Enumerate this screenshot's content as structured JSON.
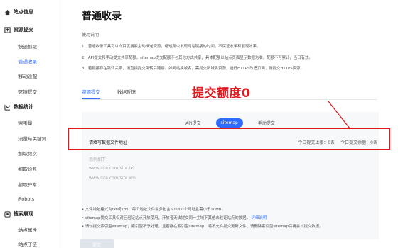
{
  "sidebar": {
    "groups": [
      {
        "label": "站点信息",
        "icon": "home-icon"
      },
      {
        "label": "资源提交",
        "icon": "upload-icon"
      },
      {
        "label": "数据统计",
        "icon": "chart-icon"
      },
      {
        "label": "搜索展现",
        "icon": "search-display-icon"
      }
    ],
    "items": [
      {
        "label": "快速抓取"
      },
      {
        "label": "普通收录"
      },
      {
        "label": "移动适配"
      },
      {
        "label": "死链提交"
      },
      {
        "label": "索引量"
      },
      {
        "label": "流量与关键词"
      },
      {
        "label": "抓取频次"
      },
      {
        "label": "抓取诊断"
      },
      {
        "label": "抓取异常"
      },
      {
        "label": "Robots"
      },
      {
        "label": "站点属性"
      },
      {
        "label": "站点子链"
      }
    ]
  },
  "page": {
    "title": "普通收录",
    "usage_title": "使用说明",
    "usage": [
      "1、普通收录工具可以向百度搜索主动推送资源，缩短爬虫发现网站链接的时间，不保证收录和展现效果。",
      "2、API提交和手动提交共享配额，sitemap提交配额不与其他方式共享，具体配额以站点页面显示数据为准，配额不可累计，当日有效。",
      "3、若链接存在跳转关系，请直接提交跳转后链接。如网站换域名，需提交新域名资源；进行HTTPS改造页面，请提交HTTPS资源。"
    ],
    "tabs": [
      "资源提交",
      "数据反馈"
    ],
    "subtabs": [
      "API提交",
      "sitemap",
      "手动提交"
    ],
    "row_label": "请填写数据文件地址",
    "quota_limit": "今日提交上限：0条",
    "quota_remaining": "今日提交余额：0条",
    "textarea_lines": [
      "示例如下：",
      "www.site.com/site.txt",
      "www.site.com/site.xml"
    ],
    "notes": [
      "• 文件地址格式为txt或xml，每个地址文件最多包含50,000个网址且需小于10MB。",
      "• sitemap提交工具仅对已验证站点开放使用，开放者无法提交同一主域下其他未验证站点的数据。",
      "• 请勿提交索引型sitemap，索引型不予处理，且若存在索引型sitemap，将不允许提交更新文件；请删除索引型sitemap后再尝试提交数据。"
    ],
    "notes_link": "详细说明",
    "submit_label": "提交"
  },
  "annotation": {
    "text": "提交额度0",
    "color": "#e0191e"
  }
}
